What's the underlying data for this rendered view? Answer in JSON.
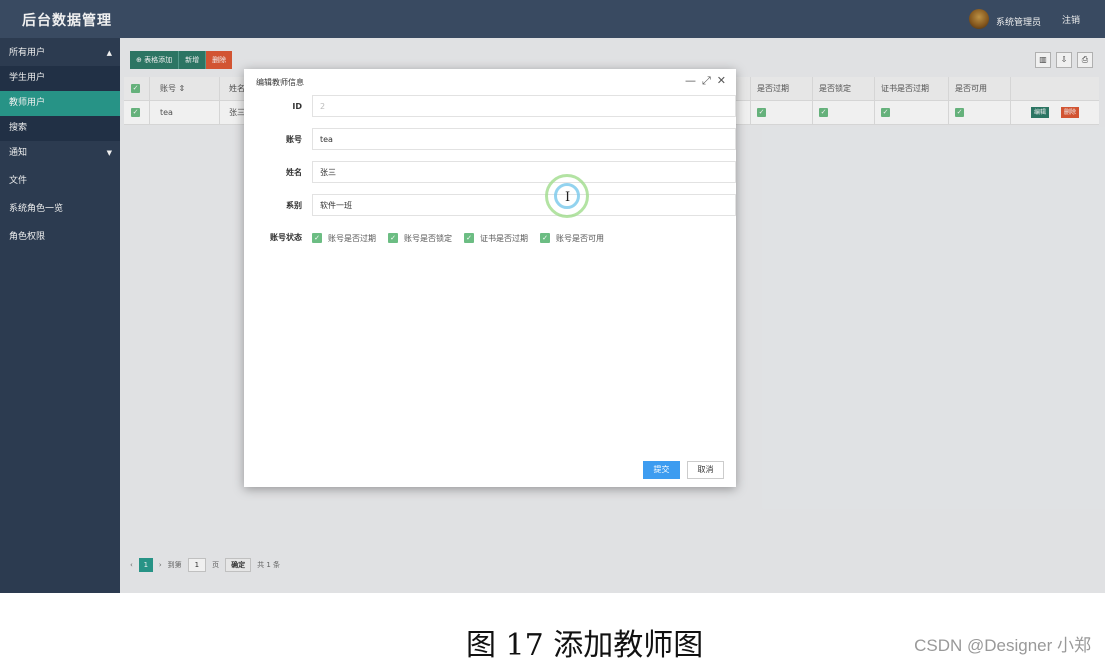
{
  "header": {
    "title": "后台数据管理",
    "user_name": "系统管理员",
    "logout": "注销"
  },
  "sidebar": {
    "items": [
      {
        "label": "所有用户",
        "arrow": "▲"
      },
      {
        "label": "学生用户"
      },
      {
        "label": "教师用户"
      },
      {
        "label": "搜索"
      },
      {
        "label": "通知",
        "arrow": "▼"
      },
      {
        "label": "文件"
      },
      {
        "label": "系统角色一览"
      },
      {
        "label": "角色权限"
      }
    ]
  },
  "toolbar": {
    "table_add": "表格添加",
    "add": "新增",
    "delete": "删除"
  },
  "table": {
    "columns": [
      "账号 ⇕",
      "姓名",
      "是否过期",
      "是否锁定",
      "证书是否过期",
      "是否可用"
    ],
    "row": {
      "account": "tea",
      "name": "张三",
      "edit": "编辑",
      "delete": "删除"
    }
  },
  "pager": {
    "current": "1",
    "goto": "到第",
    "page_input": "1",
    "page_unit": "页",
    "confirm": "确定",
    "total": "共 1 条"
  },
  "dialog": {
    "title": "编辑教师信息",
    "fields": [
      {
        "label": "ID",
        "value": "2"
      },
      {
        "label": "账号",
        "value": "tea"
      },
      {
        "label": "姓名",
        "value": "张三"
      },
      {
        "label": "系别",
        "value": "软件一班"
      }
    ],
    "status_label": "账号状态",
    "checks": [
      "账号是否过期",
      "账号是否锁定",
      "证书是否过期",
      "账号是否可用"
    ],
    "submit": "提交",
    "cancel": "取消"
  },
  "caption": "图 17 添加教师图",
  "watermark": "CSDN @Designer 小郑",
  "colors": {
    "header": "#3d4f68",
    "sidebar": "#2f3f55",
    "active": "#2a9d8f",
    "danger": "#e05a36",
    "primary": "#3d9cf0"
  }
}
